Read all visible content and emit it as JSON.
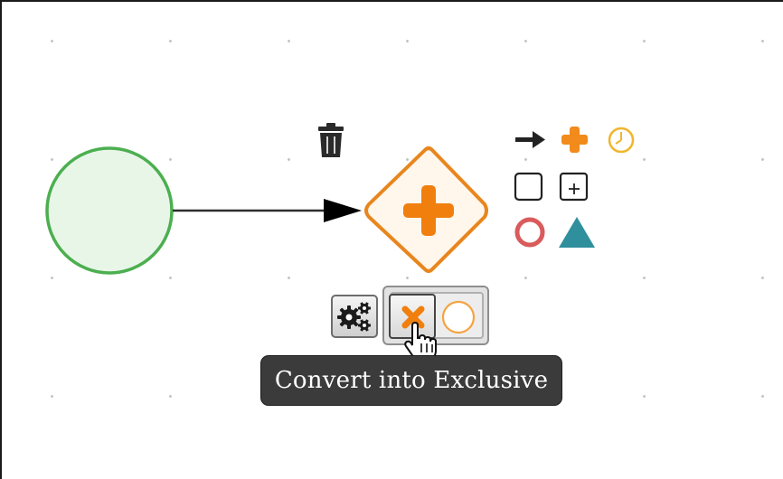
{
  "canvas": {
    "grid": "dotted"
  },
  "diagram": {
    "start_event": {
      "kind": "start-event",
      "stroke": "#4caf50",
      "fill": "#e8f6e8"
    },
    "sequence_flow": {
      "kind": "sequence-flow",
      "stroke": "#2d2d2d"
    },
    "parallel_gateway": {
      "kind": "parallel-gateway",
      "stroke": "#e8861d",
      "fill": "#fff6ec",
      "marker_color": "#f07f0e",
      "selected": true
    }
  },
  "context_pad": {
    "delete": {
      "icon": "trash-icon",
      "color": "#2a2a2a"
    },
    "append": [
      {
        "icon": "arrow-right-icon",
        "color": "#222222"
      },
      {
        "icon": "parallel-gateway-icon",
        "color": "#f28a1c"
      },
      {
        "icon": "timer-icon",
        "color": "#f1b52d"
      },
      {
        "icon": "task-icon",
        "color": "#222222"
      },
      {
        "icon": "subprocess-icon",
        "color": "#222222"
      },
      {
        "icon": "end-event-icon",
        "color": "#d95b5b"
      },
      {
        "icon": "triangle-icon",
        "color": "#2f8f9d"
      }
    ]
  },
  "morph_menu": {
    "more_button": {
      "icon": "gears-icon"
    },
    "options": [
      {
        "icon": "exclusive-gateway-icon",
        "color": "#f07f0e",
        "hovered": true
      },
      {
        "icon": "inclusive-gateway-icon",
        "color": "#f5a342"
      }
    ]
  },
  "tooltip": {
    "text": "Convert into Exclusive"
  }
}
